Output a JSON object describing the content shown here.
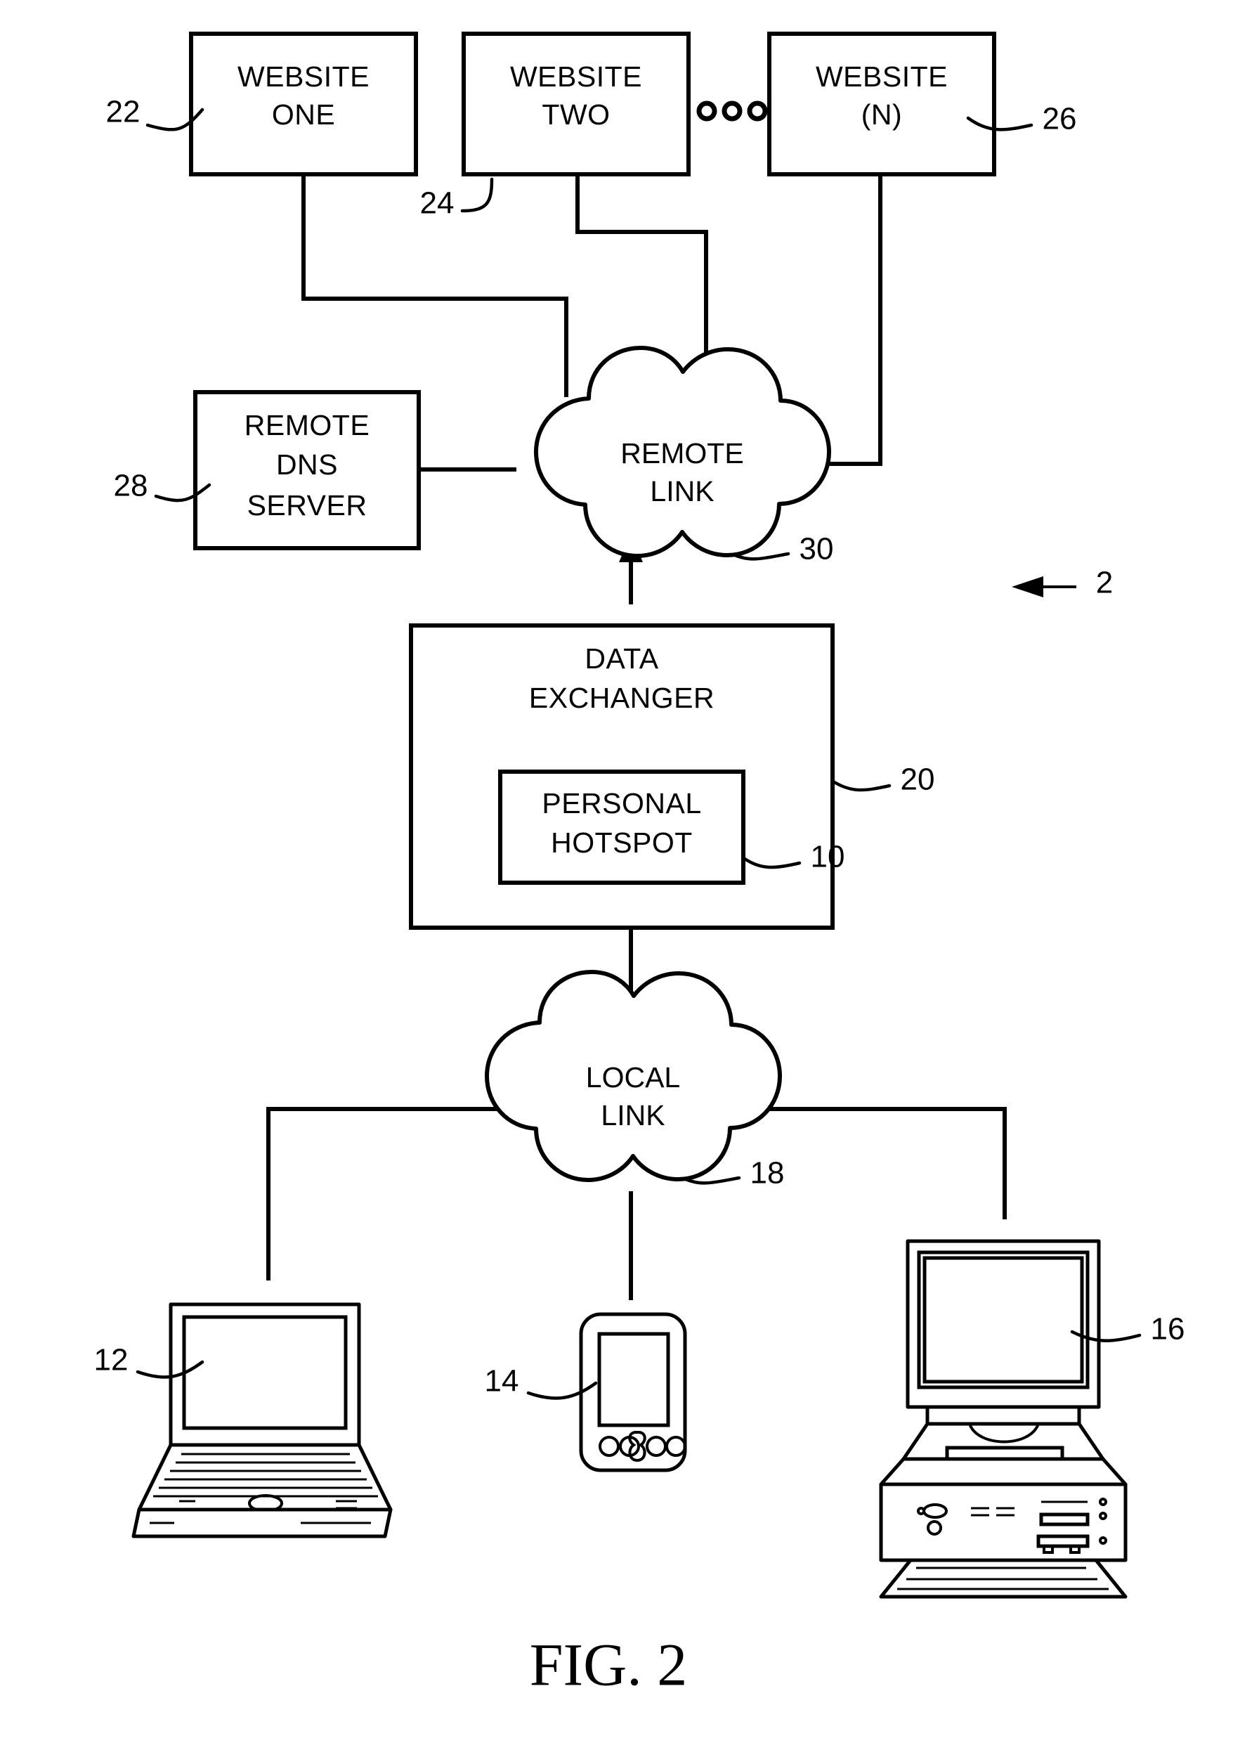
{
  "figure": {
    "caption": "FIG. 2",
    "system_ref": "2"
  },
  "nodes": {
    "website_one": {
      "line1": "WEBSITE",
      "line2": "ONE",
      "ref": "22"
    },
    "website_two": {
      "line1": "WEBSITE",
      "line2": "TWO",
      "ref": "24"
    },
    "website_n": {
      "line1": "WEBSITE",
      "line2": "(N)",
      "ref": "26"
    },
    "ellipsis": "ooo",
    "remote_dns_server": {
      "line1": "REMOTE",
      "line2": "DNS",
      "line3": "SERVER",
      "ref": "28"
    },
    "remote_link": {
      "line1": "REMOTE",
      "line2": "LINK",
      "ref": "30"
    },
    "data_exchanger": {
      "line1": "DATA",
      "line2": "EXCHANGER",
      "ref": "20"
    },
    "personal_hotspot": {
      "line1": "PERSONAL",
      "line2": "HOTSPOT",
      "ref": "10"
    },
    "local_link": {
      "line1": "LOCAL",
      "line2": "LINK",
      "ref": "18"
    },
    "laptop": {
      "ref": "12"
    },
    "handheld": {
      "ref": "14"
    },
    "desktop": {
      "ref": "16"
    }
  },
  "colors": {
    "stroke": "#000000",
    "background": "#ffffff"
  }
}
